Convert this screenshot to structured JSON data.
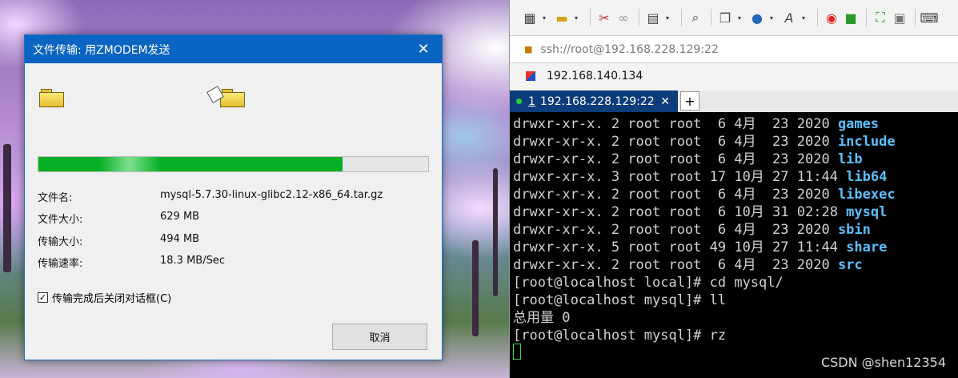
{
  "dialog": {
    "title": "文件传输: 用ZMODEM发送",
    "close_glyph": "✕",
    "progress_fraction": 0.78,
    "fields": [
      {
        "label": "文件名:",
        "value": "mysql-5.7.30-linux-glibc2.12-x86_64.tar.gz"
      },
      {
        "label": "文件大小:",
        "value": "629 MB"
      },
      {
        "label": "传输大小:",
        "value": "494 MB"
      },
      {
        "label": "传输速率:",
        "value": "18.3 MB/Sec"
      }
    ],
    "checkbox": {
      "label": "传输完成后关闭对话框(C)",
      "checked": true,
      "mark": "✓"
    },
    "cancel_label": "取消"
  },
  "toolbar": {
    "icons": [
      "new-session-icon",
      "open-folder-icon",
      "disconnect-icon",
      "reconnect-icon",
      "properties-icon",
      "find-icon",
      "copy-icon",
      "globe-icon",
      "font-icon",
      "xftp-icon",
      "xshell-icon",
      "fullscreen-icon",
      "lock-icon",
      "keyboard-icon"
    ]
  },
  "address": {
    "url": "ssh://root@192.168.228.129:22"
  },
  "bookmark": {
    "host": "192.168.140.134"
  },
  "tab": {
    "number": "1",
    "name": "192.168.228.129:22",
    "close_glyph": "✕",
    "add_glyph": "+"
  },
  "terminal": {
    "lines": [
      {
        "prefix": "drwxr-xr-x. 2 root root  6 4月  23 2020 ",
        "dir": "games"
      },
      {
        "prefix": "drwxr-xr-x. 2 root root  6 4月  23 2020 ",
        "dir": "include"
      },
      {
        "prefix": "drwxr-xr-x. 2 root root  6 4月  23 2020 ",
        "dir": "lib"
      },
      {
        "prefix": "drwxr-xr-x. 3 root root 17 10月 27 11:44 ",
        "dir": "lib64"
      },
      {
        "prefix": "drwxr-xr-x. 2 root root  6 4月  23 2020 ",
        "dir": "libexec"
      },
      {
        "prefix": "drwxr-xr-x. 2 root root  6 10月 31 02:28 ",
        "dir": "mysql"
      },
      {
        "prefix": "drwxr-xr-x. 2 root root  6 4月  23 2020 ",
        "dir": "sbin"
      },
      {
        "prefix": "drwxr-xr-x. 5 root root 49 10月 27 11:44 ",
        "dir": "share"
      },
      {
        "prefix": "drwxr-xr-x. 2 root root  6 4月  23 2020 ",
        "dir": "src"
      },
      {
        "prefix": "[root@localhost local]# cd mysql/",
        "dir": ""
      },
      {
        "prefix": "[root@localhost mysql]# ll",
        "dir": ""
      },
      {
        "prefix": "总用量 0",
        "dir": ""
      },
      {
        "prefix": "[root@localhost mysql]# rz",
        "dir": ""
      }
    ],
    "colors": {
      "background": "#000000",
      "text": "#d2d2d2",
      "directory": "#5bc0ff",
      "cursor": "#2ae04a"
    }
  },
  "watermark": "CSDN @shen12354"
}
